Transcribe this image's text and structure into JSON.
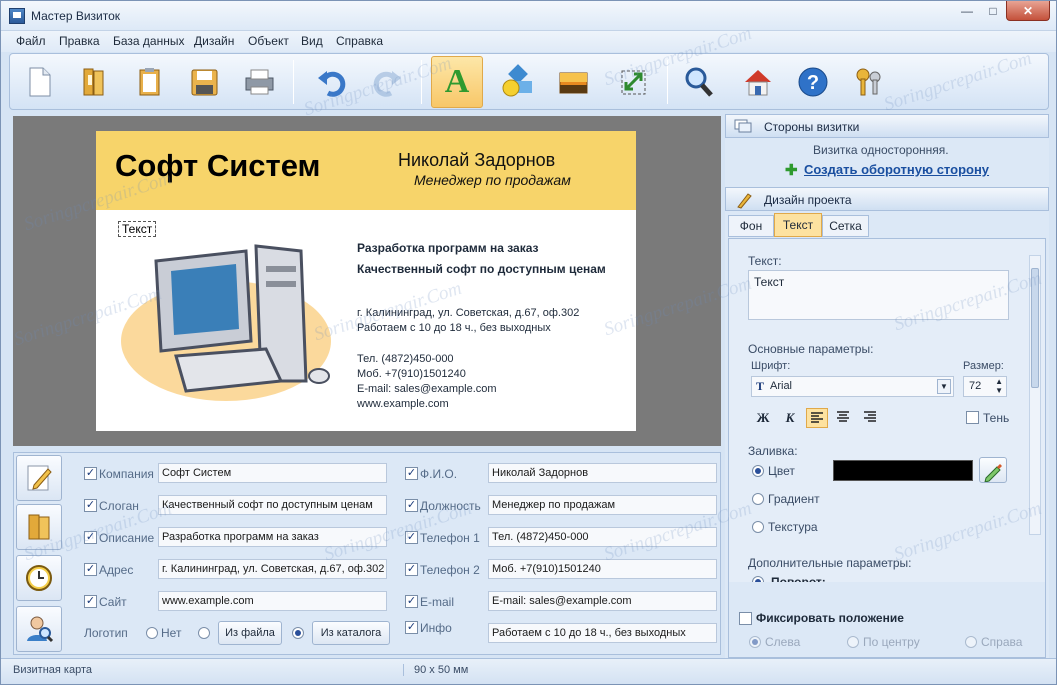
{
  "window": {
    "title": "Мастер Визиток",
    "minimize": "—",
    "maximize": "□",
    "close": "✕"
  },
  "menu": [
    "Файл",
    "Правка",
    "База данных",
    "Дизайн",
    "Объект",
    "Вид",
    "Справка"
  ],
  "toolbar": {
    "buttons": [
      "new-doc-icon",
      "open-book-icon",
      "clipboard-icon",
      "save-floppy-icon",
      "printer-icon",
      "undo-icon",
      "redo-icon",
      "text-tool-icon",
      "shapes-tool-icon",
      "image-tool-icon",
      "resize-tool-icon",
      "zoom-icon",
      "home-icon",
      "help-icon",
      "keys-icon"
    ],
    "text_tool_glyph": "A"
  },
  "card": {
    "company": "Софт Систем",
    "person": "Николай Задорнов",
    "position": "Менеджер по продажам",
    "selected_text": "Текст",
    "description": "Разработка программ на заказ",
    "slogan": "Качественный софт по доступным ценам",
    "address": "г. Калининград, ул. Советская, д.67, оф.302",
    "hours": "Работаем с 10 до 18 ч., без выходных",
    "phone": "Тел. (4872)450-000",
    "mobile": "Моб. +7(910)1501240",
    "email": "E-mail: sales@example.com",
    "website": "www.example.com",
    "band_color": "#f7d46a"
  },
  "fields": {
    "left": [
      {
        "label": "Компания",
        "value": "Софт Систем"
      },
      {
        "label": "Слоган",
        "value": "Качественный софт по доступным ценам"
      },
      {
        "label": "Описание",
        "value": "Разработка программ на заказ"
      },
      {
        "label": "Адрес",
        "value": "г. Калининград, ул. Советская, д.67, оф.302"
      },
      {
        "label": "Сайт",
        "value": "www.example.com"
      }
    ],
    "right": [
      {
        "label": "Ф.И.О.",
        "value": "Николай Задорнов"
      },
      {
        "label": "Должность",
        "value": "Менеджер по продажам"
      },
      {
        "label": "Телефон 1",
        "value": "Тел. (4872)450-000"
      },
      {
        "label": "Телефон 2",
        "value": "Моб. +7(910)1501240"
      },
      {
        "label": "E-mail",
        "value": "E-mail: sales@example.com"
      },
      {
        "label": "Инфо",
        "value": "Работаем с 10 до 18 ч., без выходных"
      }
    ],
    "logo_label": "Логотип",
    "logo_none": "Нет",
    "logo_from_file": "Из файла",
    "logo_from_catalog": "Из каталога"
  },
  "right_panel": {
    "sides_header": "Стороны визитки",
    "sides_info": "Визитка односторонняя.",
    "create_back": "Создать оборотную сторону",
    "design_header": "Дизайн проекта",
    "tabs": [
      "Фон",
      "Текст",
      "Сетка"
    ],
    "active_tab": "Текст",
    "text_group": "Текст:",
    "text_value": "Текст",
    "basic_group": "Основные параметры:",
    "font_label": "Шрифт:",
    "font_value": "Arial",
    "size_label": "Размер:",
    "size_value": "72",
    "bold_btn": "Ж",
    "italic_btn": "К",
    "shadow_label": "Тень",
    "fill_group": "Заливка:",
    "fill_color": "Цвет",
    "fill_gradient": "Градиент",
    "fill_texture": "Текстура",
    "fill_swatch": "#000000",
    "extra_group": "Дополнительные параметры:",
    "extra_partial": "Поворот:",
    "fix_position": "Фиксировать положение",
    "align_left": "Слева",
    "align_center": "По центру",
    "align_right": "Справа"
  },
  "status": {
    "left": "Визитная карта",
    "size": "90 x 50 мм"
  },
  "watermark": "Soringpcrepair.Com"
}
